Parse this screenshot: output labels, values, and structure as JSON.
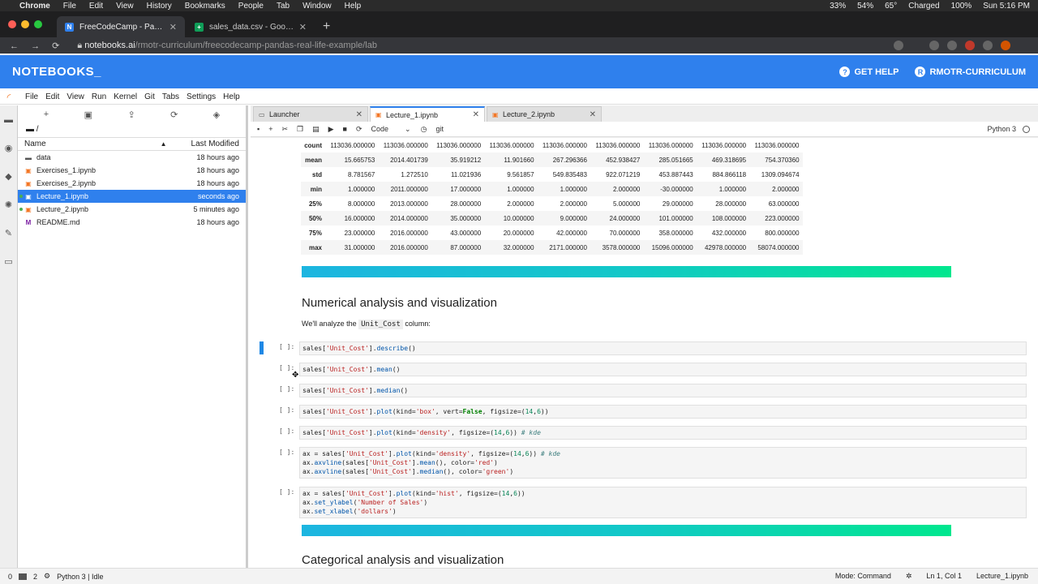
{
  "macos": {
    "app": "Chrome",
    "menus": [
      "File",
      "Edit",
      "View",
      "History",
      "Bookmarks",
      "People",
      "Tab",
      "Window",
      "Help"
    ],
    "status_items": [
      "33%",
      "54%",
      "65°",
      "Charged",
      "100%",
      "Sun 5:16 PM"
    ]
  },
  "browser": {
    "tabs": [
      {
        "title": "FreeCodeCamp - Pandas Real Li...",
        "icon": "N",
        "color": "#2f80ed",
        "active": true
      },
      {
        "title": "sales_data.csv - Google Sheets",
        "icon": "+",
        "color": "#0f9d58",
        "active": false
      }
    ],
    "url_host": "notebooks.ai",
    "url_path": "/rmotr-curriculum/freecodecamp-pandas-real-life-example/lab"
  },
  "header": {
    "logo": "NOTEBOOKS_",
    "help": "GET HELP",
    "user": "RMOTR-CURRICULUM",
    "user_initial": "R"
  },
  "jupyter_menu": [
    "File",
    "Edit",
    "View",
    "Run",
    "Kernel",
    "Git",
    "Tabs",
    "Settings",
    "Help"
  ],
  "filebrowser": {
    "path": "/",
    "col_name": "Name",
    "col_modified": "Last Modified",
    "files": [
      {
        "name": "data",
        "modified": "18 hours ago",
        "type": "folder",
        "selected": false,
        "running": false
      },
      {
        "name": "Exercises_1.ipynb",
        "modified": "18 hours ago",
        "type": "notebook",
        "selected": false,
        "running": false
      },
      {
        "name": "Exercises_2.ipynb",
        "modified": "18 hours ago",
        "type": "notebook",
        "selected": false,
        "running": false
      },
      {
        "name": "Lecture_1.ipynb",
        "modified": "seconds ago",
        "type": "notebook",
        "selected": true,
        "running": true
      },
      {
        "name": "Lecture_2.ipynb",
        "modified": "5 minutes ago",
        "type": "notebook",
        "selected": false,
        "running": true
      },
      {
        "name": "README.md",
        "modified": "18 hours ago",
        "type": "markdown",
        "selected": false,
        "running": false
      }
    ]
  },
  "doc_tabs": [
    {
      "title": "Launcher",
      "active": false
    },
    {
      "title": "Lecture_1.ipynb",
      "active": true
    },
    {
      "title": "Lecture_2.ipynb",
      "active": false
    }
  ],
  "toolbar": {
    "cell_type": "Code",
    "git_label": "git",
    "kernel": "Python 3"
  },
  "describe_table": {
    "rows": [
      {
        "label": "count",
        "values": [
          "113036.000000",
          "113036.000000",
          "113036.000000",
          "113036.000000",
          "113036.000000",
          "113036.000000",
          "113036.000000",
          "113036.000000",
          "113036.000000"
        ]
      },
      {
        "label": "mean",
        "values": [
          "15.665753",
          "2014.401739",
          "35.919212",
          "11.901660",
          "267.296366",
          "452.938427",
          "285.051665",
          "469.318695",
          "754.370360"
        ]
      },
      {
        "label": "std",
        "values": [
          "8.781567",
          "1.272510",
          "11.021936",
          "9.561857",
          "549.835483",
          "922.071219",
          "453.887443",
          "884.866118",
          "1309.094674"
        ]
      },
      {
        "label": "min",
        "values": [
          "1.000000",
          "2011.000000",
          "17.000000",
          "1.000000",
          "1.000000",
          "2.000000",
          "-30.000000",
          "1.000000",
          "2.000000"
        ]
      },
      {
        "label": "25%",
        "values": [
          "8.000000",
          "2013.000000",
          "28.000000",
          "2.000000",
          "2.000000",
          "5.000000",
          "29.000000",
          "28.000000",
          "63.000000"
        ]
      },
      {
        "label": "50%",
        "values": [
          "16.000000",
          "2014.000000",
          "35.000000",
          "10.000000",
          "9.000000",
          "24.000000",
          "101.000000",
          "108.000000",
          "223.000000"
        ]
      },
      {
        "label": "75%",
        "values": [
          "23.000000",
          "2016.000000",
          "43.000000",
          "20.000000",
          "42.000000",
          "70.000000",
          "358.000000",
          "432.000000",
          "800.000000"
        ]
      },
      {
        "label": "max",
        "values": [
          "31.000000",
          "2016.000000",
          "87.000000",
          "32.000000",
          "2171.000000",
          "3578.000000",
          "15096.000000",
          "42978.000000",
          "58074.000000"
        ]
      }
    ]
  },
  "notebook": {
    "heading": "Numerical analysis and visualization",
    "intro_before": "We'll analyze the ",
    "intro_code": "Unit_Cost",
    "intro_after": " column:",
    "prompt": "[ ]:",
    "next_heading": "Categorical analysis and visualization"
  },
  "statusbar": {
    "num_a": "0",
    "num_b": "2",
    "kernel_status": "Python 3 | Idle",
    "mode": "Mode: Command",
    "position": "Ln 1, Col 1",
    "file": "Lecture_1.ipynb"
  }
}
